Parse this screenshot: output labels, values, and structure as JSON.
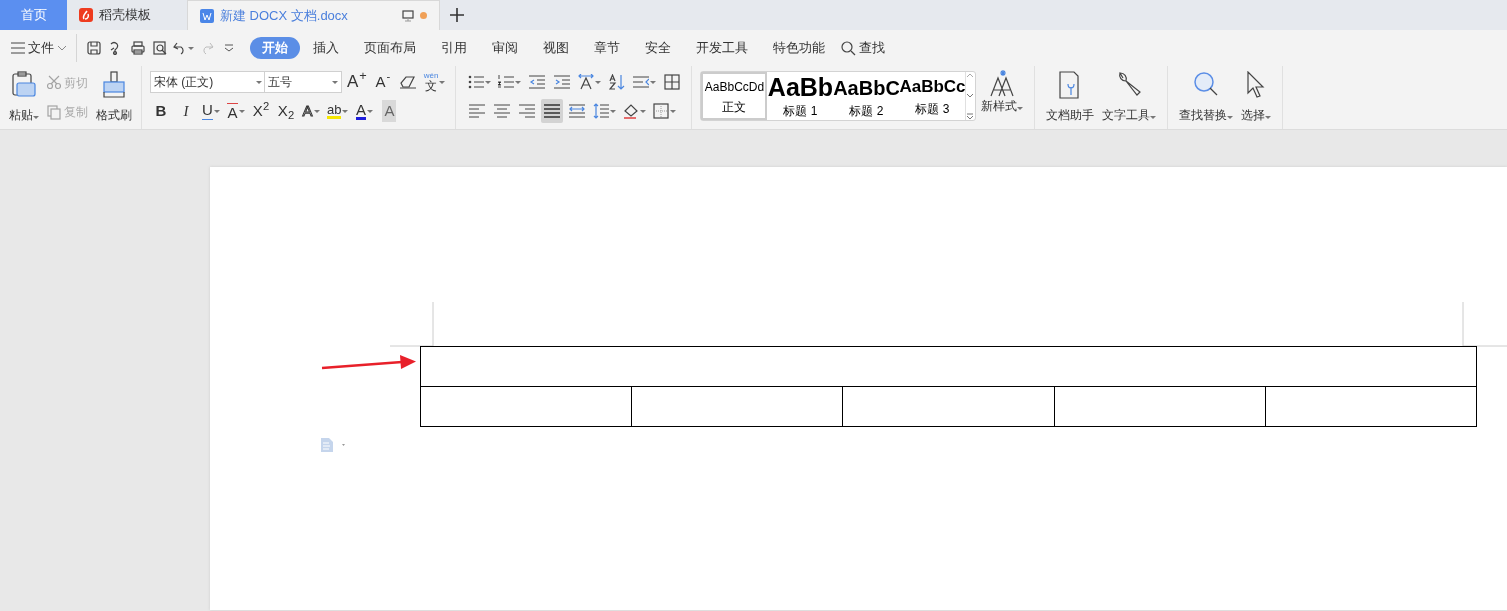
{
  "tabs": [
    {
      "label": "首页",
      "kind": "home",
      "selected": false,
      "unsaved": false
    },
    {
      "label": "稻壳模板",
      "kind": "docer",
      "selected": false,
      "unsaved": false
    },
    {
      "label": "新建 DOCX 文档.docx",
      "kind": "document",
      "selected": true,
      "unsaved": true
    }
  ],
  "menu": {
    "file_label": "文件",
    "ribbon_tabs": [
      {
        "label": "开始",
        "selected": true
      },
      {
        "label": "插入",
        "selected": false
      },
      {
        "label": "页面布局",
        "selected": false
      },
      {
        "label": "引用",
        "selected": false
      },
      {
        "label": "审阅",
        "selected": false
      },
      {
        "label": "视图",
        "selected": false
      },
      {
        "label": "章节",
        "selected": false
      },
      {
        "label": "安全",
        "selected": false
      },
      {
        "label": "开发工具",
        "selected": false
      },
      {
        "label": "特色功能",
        "selected": false
      }
    ],
    "search_label": "查找"
  },
  "ribbon": {
    "paste": {
      "label": "粘贴",
      "dropdown": true
    },
    "cut": {
      "label": "剪切",
      "disabled": true
    },
    "copy": {
      "label": "复制",
      "disabled": true
    },
    "format_painter": {
      "label": "格式刷"
    },
    "font_name": "宋体 (正文)",
    "font_size": "五号",
    "font_top": [
      {
        "kind": "grow",
        "glyph": "A$^{+}$"
      },
      {
        "kind": "shrink",
        "glyph": "A$^{-}$"
      }
    ],
    "phonetic": {
      "pinyin": "wén",
      "char": "文"
    },
    "font_buttons": [
      {
        "kind": "bold",
        "glyph": "B",
        "dropdown": false
      },
      {
        "kind": "italic",
        "glyph": "I",
        "dropdown": false
      },
      {
        "kind": "underline",
        "glyph": "U",
        "dropdown": true
      },
      {
        "kind": "strike",
        "glyph": "A",
        "dropdown": true
      },
      {
        "kind": "plain",
        "glyph": "X$^{2}$",
        "dropdown": false
      },
      {
        "kind": "plain",
        "glyph": "X$_{2}$",
        "dropdown": false
      },
      {
        "kind": "outline",
        "glyph": "A",
        "dropdown": true
      },
      {
        "kind": "highlight",
        "glyph": "ab",
        "dropdown": true
      },
      {
        "kind": "color",
        "glyph": "A",
        "dropdown": true
      },
      {
        "kind": "shade",
        "glyph": "A",
        "dropdown": false
      }
    ],
    "paragraph_top": [
      {
        "kind": "bullets",
        "dropdown": true
      },
      {
        "kind": "numbering",
        "dropdown": true
      },
      {
        "kind": "outdent",
        "dropdown": false
      },
      {
        "kind": "indent",
        "dropdown": false
      },
      {
        "kind": "direction",
        "dropdown": true
      },
      {
        "kind": "sort",
        "dropdown": false
      },
      {
        "kind": "wrap",
        "dropdown": true
      },
      {
        "kind": "grid",
        "dropdown": false
      }
    ],
    "paragraph_bottom": [
      {
        "kind": "align-left",
        "selected": false,
        "dropdown": false
      },
      {
        "kind": "align-center",
        "selected": false,
        "dropdown": false
      },
      {
        "kind": "align-right",
        "selected": false,
        "dropdown": false
      },
      {
        "kind": "justify",
        "selected": true,
        "dropdown": false
      },
      {
        "kind": "distributed",
        "selected": false,
        "dropdown": false
      },
      {
        "kind": "spacing",
        "selected": false,
        "dropdown": true
      },
      {
        "kind": "shading",
        "selected": false,
        "dropdown": true
      },
      {
        "kind": "borders",
        "selected": false,
        "dropdown": true
      }
    ],
    "styles": [
      {
        "preview": "AaBbCcDd",
        "label": "正文",
        "kind": "body",
        "selected": true
      },
      {
        "preview": "AaBb",
        "label": "标题 1",
        "kind": "h1",
        "selected": false
      },
      {
        "preview": "AaBbC",
        "label": "标题 2",
        "kind": "h2",
        "selected": false
      },
      {
        "preview": "AaBbCc",
        "label": "标题 3",
        "kind": "h3",
        "selected": false
      }
    ],
    "new_style": {
      "label": "新样式",
      "dropdown": true
    },
    "tools": [
      {
        "label": "文档助手",
        "kind": "assistant",
        "dropdown": false
      },
      {
        "label": "文字工具",
        "kind": "wrench",
        "dropdown": true
      },
      {
        "label": "查找替换",
        "kind": "search",
        "dropdown": true
      },
      {
        "label": "选择",
        "kind": "pointer",
        "dropdown": true
      }
    ]
  },
  "document": {
    "table": {
      "rows": [
        {
          "merged": true
        },
        {
          "merged": false
        }
      ]
    }
  }
}
